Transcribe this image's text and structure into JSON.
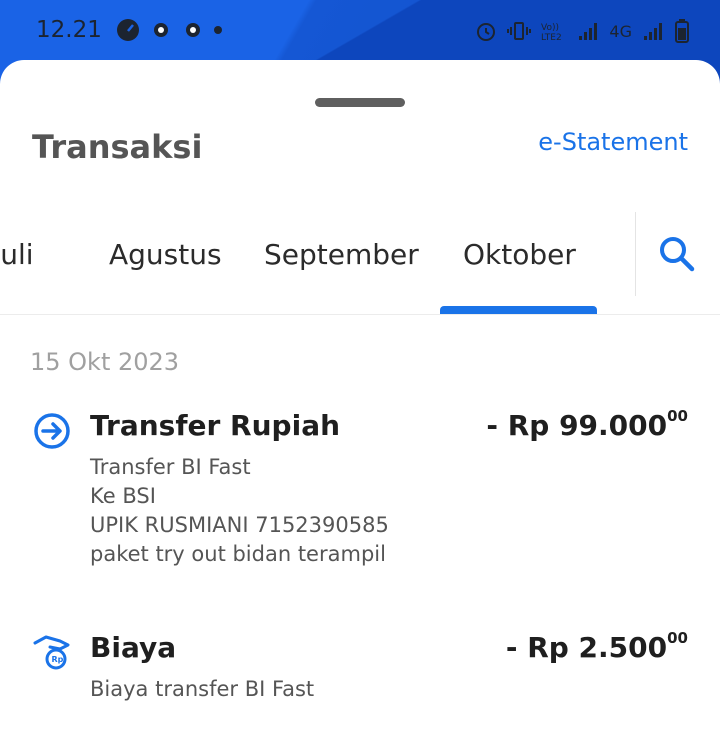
{
  "status_bar": {
    "time": "12.21",
    "right_text": "4G"
  },
  "header": {
    "title": "Transaksi",
    "estatement_label": "e-Statement"
  },
  "tabs": [
    {
      "label": "Juli"
    },
    {
      "label": "Agustus"
    },
    {
      "label": "September"
    },
    {
      "label": "Oktober",
      "active": true
    }
  ],
  "date_header": "15 Okt 2023",
  "transactions": [
    {
      "icon": "transfer-arrow-icon",
      "title": "Transfer Rupiah",
      "amount_main": "- Rp 99.000",
      "amount_cents": "00",
      "details": [
        "Transfer BI Fast",
        "Ke BSI",
        "UPIK RUSMIANI 7152390585",
        "paket try out bidan terampil"
      ]
    },
    {
      "icon": "fee-hand-icon",
      "title": "Biaya",
      "amount_main": "- Rp 2.500",
      "amount_cents": "00",
      "details": [
        "Biaya transfer BI Fast"
      ]
    }
  ],
  "colors": {
    "accent": "#1a73e8",
    "status_bar_bg": "#1a63e6",
    "text_dark": "#1f1f1f",
    "text_muted": "#a0a0a0"
  }
}
